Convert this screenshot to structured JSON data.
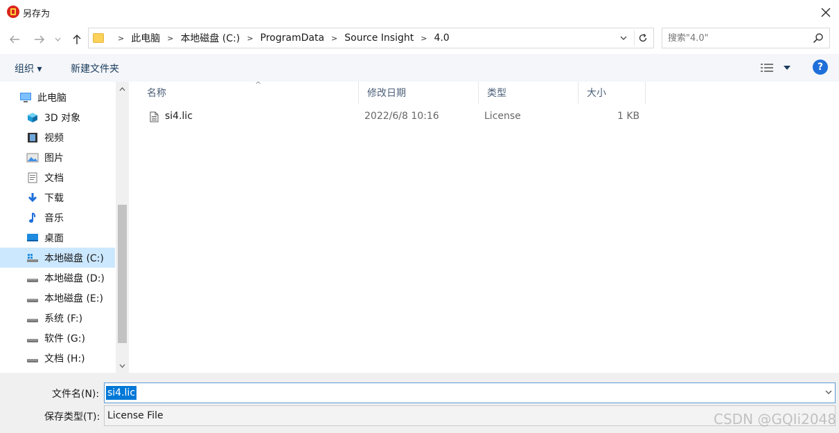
{
  "window": {
    "title": "另存为",
    "close": "✕"
  },
  "address": {
    "crumbs": [
      "此电脑",
      "本地磁盘 (C:)",
      "ProgramData",
      "Source Insight",
      "4.0"
    ],
    "search_placeholder": "搜索\"4.0\""
  },
  "toolbar": {
    "organize_label": "组织 ▾",
    "new_folder_label": "新建文件夹"
  },
  "sidebar": {
    "items": [
      {
        "label": "此电脑",
        "icon": "pc-icon"
      },
      {
        "label": "3D 对象",
        "icon": "cube-icon"
      },
      {
        "label": "视频",
        "icon": "video-icon"
      },
      {
        "label": "图片",
        "icon": "picture-icon"
      },
      {
        "label": "文档",
        "icon": "document-icon"
      },
      {
        "label": "下载",
        "icon": "download-icon"
      },
      {
        "label": "音乐",
        "icon": "music-icon"
      },
      {
        "label": "桌面",
        "icon": "desktop-icon"
      },
      {
        "label": "本地磁盘 (C:)",
        "icon": "drive-icon",
        "selected": true
      },
      {
        "label": "本地磁盘 (D:)",
        "icon": "drive-icon"
      },
      {
        "label": "本地磁盘 (E:)",
        "icon": "drive-icon"
      },
      {
        "label": "系统 (F:)",
        "icon": "drive-icon"
      },
      {
        "label": "软件 (G:)",
        "icon": "drive-icon"
      },
      {
        "label": "文档 (H:)",
        "icon": "drive-icon"
      }
    ]
  },
  "columns": {
    "name": "名称",
    "date": "修改日期",
    "type": "类型",
    "size": "大小"
  },
  "files": [
    {
      "name": "si4.lic",
      "date": "2022/6/8 10:16",
      "type": "License",
      "size": "1 KB"
    }
  ],
  "bottom": {
    "filename_label": "文件名(N):",
    "filename_value": "si4.lic",
    "filetype_label": "保存类型(T):",
    "filetype_value": "License File"
  },
  "watermark": "CSDN @GQIi2048",
  "colors": {
    "accent": "#0078d7",
    "selected_bg": "#cce8ff",
    "toolbar_bg": "#f4f6f9",
    "help": "#1e6fd9"
  }
}
